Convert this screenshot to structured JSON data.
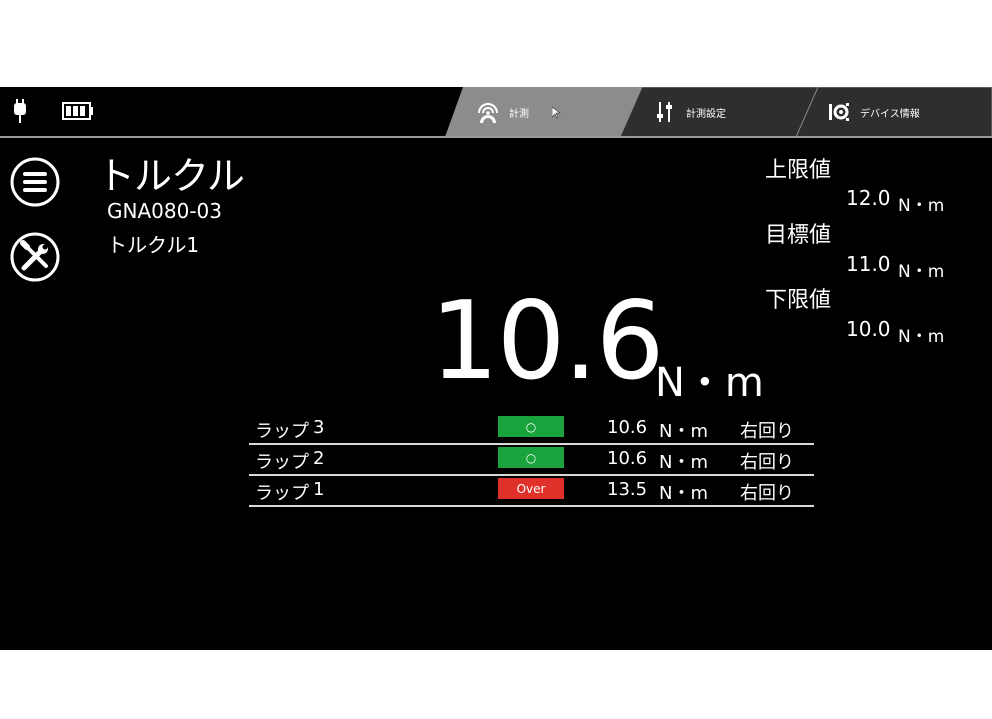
{
  "tabs": [
    {
      "label": "計測",
      "icon": "signal-gauge-icon",
      "active": true
    },
    {
      "label": "計測設定",
      "icon": "sliders-icon",
      "active": false
    },
    {
      "label": "デバイス情報",
      "icon": "device-gear-icon",
      "active": false
    }
  ],
  "status": {
    "battery_level": 1.0
  },
  "device": {
    "title": "トルクル",
    "model": "GNA080-03",
    "name": "トルクル1"
  },
  "limits": {
    "upper_label": "上限値",
    "upper_value": "12.0",
    "target_label": "目標値",
    "target_value": "11.0",
    "lower_label": "下限値",
    "lower_value": "10.0",
    "unit": "N・m"
  },
  "reading": {
    "value": "10.6",
    "unit": "N・m"
  },
  "laps": [
    {
      "label": "ラップ",
      "num": "3",
      "result": "○",
      "status": "ok",
      "value": "10.6",
      "unit": "N・m",
      "direction": "右回り"
    },
    {
      "label": "ラップ",
      "num": "2",
      "result": "○",
      "status": "ok",
      "value": "10.6",
      "unit": "N・m",
      "direction": "右回り"
    },
    {
      "label": "ラップ",
      "num": "1",
      "result": "Over",
      "status": "over",
      "value": "13.5",
      "unit": "N・m",
      "direction": "右回り"
    }
  ],
  "colors": {
    "ok": "#1aa33c",
    "over": "#e0302a",
    "active_tab": "#8c8c8c",
    "tab": "#3a3a3a"
  }
}
